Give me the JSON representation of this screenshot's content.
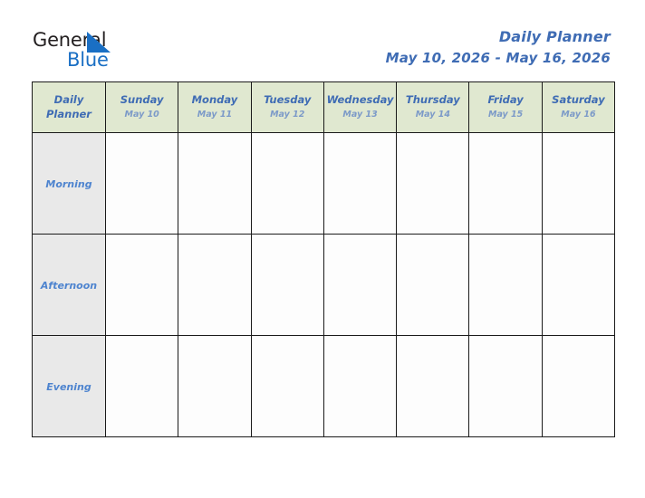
{
  "brand": {
    "name_dark": "General",
    "name_blue": "Blue",
    "mark_icon": "blue-triangle-icon",
    "mark_color": "#1a6fc4",
    "dark_color": "#231f20"
  },
  "header": {
    "title": "Daily Planner",
    "date_range": "May 10, 2026 - May 16, 2026",
    "title_color": "#3f6cb4"
  },
  "table": {
    "corner": {
      "line1": "Daily",
      "line2": "Planner"
    },
    "header_bg": "#e0e8d0",
    "label_bg": "#e9e9e9",
    "cell_bg": "#fdfdfd",
    "border_color": "#1a1a1a",
    "days": [
      {
        "name": "Sunday",
        "date": "May 10"
      },
      {
        "name": "Monday",
        "date": "May 11"
      },
      {
        "name": "Tuesday",
        "date": "May 12"
      },
      {
        "name": "Wednesday",
        "date": "May 13"
      },
      {
        "name": "Thursday",
        "date": "May 14"
      },
      {
        "name": "Friday",
        "date": "May 15"
      },
      {
        "name": "Saturday",
        "date": "May 16"
      }
    ],
    "periods": [
      {
        "label": "Morning",
        "entries": [
          "",
          "",
          "",
          "",
          "",
          "",
          ""
        ]
      },
      {
        "label": "Afternoon",
        "entries": [
          "",
          "",
          "",
          "",
          "",
          "",
          ""
        ]
      },
      {
        "label": "Evening",
        "entries": [
          "",
          "",
          "",
          "",
          "",
          "",
          ""
        ]
      }
    ]
  }
}
